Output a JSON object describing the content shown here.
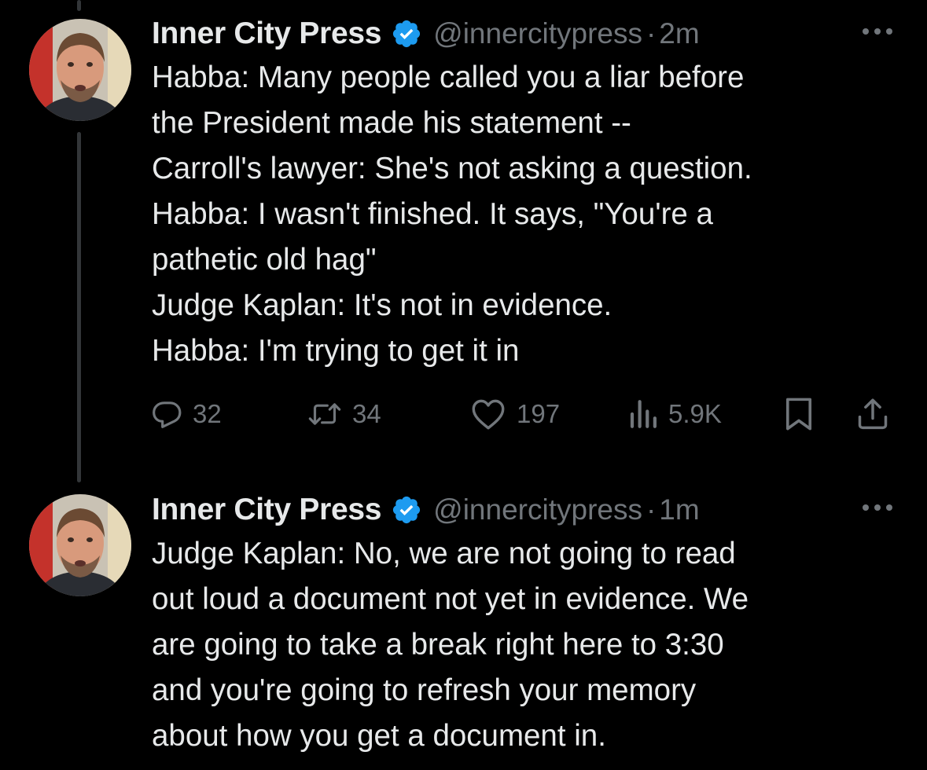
{
  "tweets": [
    {
      "author_name": "Inner City Press",
      "handle": "@innercitypress",
      "separator": "·",
      "time": "2m",
      "lines": [
        "Habba: Many people called you a liar before",
        "the President made his statement --",
        "Carroll's lawyer: She's not asking a question.",
        "Habba: I wasn't finished. It says, \"You're a",
        "pathetic old hag\"",
        "Judge Kaplan: It's not in evidence.",
        "Habba: I'm trying to get it in"
      ],
      "replies": "32",
      "reposts": "34",
      "likes": "197",
      "views": "5.9K"
    },
    {
      "author_name": "Inner City Press",
      "handle": "@innercitypress",
      "separator": "·",
      "time": "1m",
      "lines": [
        "Judge Kaplan: No, we are not going to read",
        "out loud a document not yet in evidence. We",
        "are going to take a break right here to 3:30",
        "and you're going to refresh your memory",
        "about how you get a document in."
      ]
    }
  ],
  "icons": {
    "verified": "verified-badge-icon",
    "more": "more-options-icon",
    "reply": "reply-icon",
    "repost": "repost-icon",
    "like": "like-icon",
    "views": "views-icon",
    "bookmark": "bookmark-icon",
    "share": "share-icon"
  },
  "colors": {
    "background": "#000000",
    "text": "#e7e9ea",
    "secondary": "#71767b",
    "verified": "#1d9bf0",
    "thread_line": "#333639"
  }
}
